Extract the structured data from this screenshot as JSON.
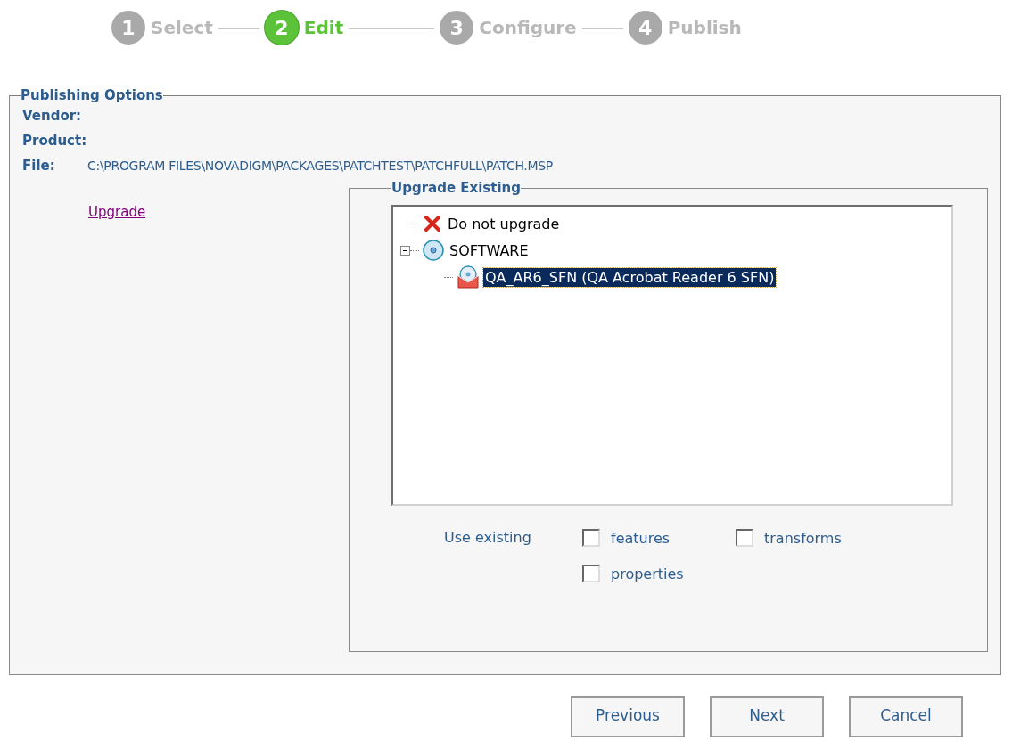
{
  "steps": [
    {
      "number": "1",
      "label": "Select",
      "selected": false
    },
    {
      "number": "2",
      "label": "Edit",
      "selected": true
    },
    {
      "number": "3",
      "label": "Configure",
      "selected": false
    },
    {
      "number": "4",
      "label": "Publish",
      "selected": false
    }
  ],
  "publishing_options": {
    "title": "Publishing Options",
    "fields": [
      {
        "label": "Vendor:"
      },
      {
        "label": "Product:"
      },
      {
        "label": "File:",
        "value": "C:\\PROGRAM FILES\\NOVADIGM\\PACKAGES\\PATCHTEST\\PATCHFULL\\PATCH.MSP"
      }
    ],
    "link": "Upgrade",
    "upgrade_existing": {
      "title": "Upgrade Existing",
      "tree": [
        {
          "kind": "none",
          "label": "Do not upgrade",
          "selected": false
        },
        {
          "kind": "folder",
          "label": "SOFTWARE",
          "selected": false,
          "expanded": true,
          "children": [
            {
              "kind": "package",
              "label": "QA_AR6_SFN (QA Acrobat Reader 6 SFN)",
              "selected": true
            }
          ]
        }
      ],
      "use_existing_label": "Use existing",
      "options": [
        {
          "label": "features",
          "checked": false
        },
        {
          "label": "transforms",
          "checked": false
        },
        {
          "label": "properties",
          "checked": false
        }
      ]
    }
  },
  "buttons": [
    "Previous",
    "Next",
    "Cancel"
  ]
}
